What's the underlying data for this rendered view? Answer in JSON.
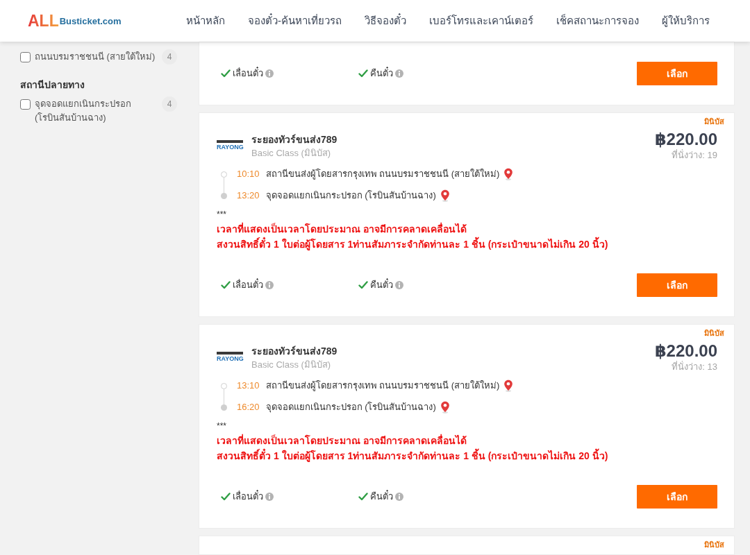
{
  "header": {
    "logo": {
      "brand": "ALL",
      "domain": "Busticket.com"
    },
    "nav": [
      {
        "label": "หน้าหลัก"
      },
      {
        "label": "จองตั๋ว-ค้นหาเที่ยวรถ"
      },
      {
        "label": "วิธีจองตั๋ว"
      },
      {
        "label": "เบอร์โทรและเคาน์เตอร์"
      },
      {
        "label": "เช็คสถานะการจอง"
      },
      {
        "label": "ผู้ให้บริการ"
      }
    ]
  },
  "sidebar": {
    "groups": [
      {
        "items": [
          {
            "label": "ถนนบรมราชชนนี (สายใต้ใหม่)",
            "count": "4",
            "checked": false
          }
        ]
      },
      {
        "heading": "สถานีปลายทาง",
        "items": [
          {
            "label": "จุดจอดแยกเนินกระปรอก (โรบินสันบ้านฉาง)",
            "count": "4",
            "checked": false
          }
        ]
      }
    ]
  },
  "trips": [
    {
      "features": [
        {
          "label": "เลื่อนตั๋ว",
          "allowed": true
        },
        {
          "label": "คืนตั๋ว",
          "allowed": true
        }
      ],
      "select_button": "เลือก"
    },
    {
      "tag": "มินิบัส",
      "operator": {
        "logo_text": "RAYONG",
        "name": "ระยองทัวร์ขนส่ง789",
        "class": "Basic Class (มินิบัส)"
      },
      "price": "฿220.00",
      "seats": "ที่นั่งว่าง: 19",
      "stops": [
        {
          "kind": "departure",
          "time": "10:10",
          "station": "สถานีขนส่งผู้โดยสารกรุงเทพ ถนนบรมราชชนนี (สายใต้ใหม่)"
        },
        {
          "kind": "arrival",
          "time": "13:20",
          "station": "จุดจอดแยกเนินกระปรอก (โรบินสันบ้านฉาง)"
        }
      ],
      "note_marker": "***",
      "notes": [
        "เวลาที่แสดงเป็นเวลาโดยประมาณ อาจมีการคลาดเคลื่อนได้",
        "สงวนสิทธิ์ตั๋ว 1 ใบต่อผู้โดยสาร 1ท่านสัมภาระจำกัดท่านละ 1 ชิ้น (กระเป๋าขนาดไม่เกิน 20 นิ้ว)"
      ],
      "features": [
        {
          "label": "เลื่อนตั๋ว",
          "allowed": true
        },
        {
          "label": "คืนตั๋ว",
          "allowed": true
        }
      ],
      "select_button": "เลือก"
    },
    {
      "tag": "มินิบัส",
      "operator": {
        "logo_text": "RAYONG",
        "name": "ระยองทัวร์ขนส่ง789",
        "class": "Basic Class (มินิบัส)"
      },
      "price": "฿220.00",
      "seats": "ที่นั่งว่าง: 13",
      "stops": [
        {
          "kind": "departure",
          "time": "13:10",
          "station": "สถานีขนส่งผู้โดยสารกรุงเทพ ถนนบรมราชชนนี (สายใต้ใหม่)"
        },
        {
          "kind": "arrival",
          "time": "16:20",
          "station": "จุดจอดแยกเนินกระปรอก (โรบินสันบ้านฉาง)"
        }
      ],
      "note_marker": "***",
      "notes": [
        "เวลาที่แสดงเป็นเวลาโดยประมาณ อาจมีการคลาดเคลื่อนได้",
        "สงวนสิทธิ์ตั๋ว 1 ใบต่อผู้โดยสาร 1ท่านสัมภาระจำกัดท่านละ 1 ชิ้น (กระเป๋าขนาดไม่เกิน 20 นิ้ว)"
      ],
      "features": [
        {
          "label": "เลื่อนตั๋ว",
          "allowed": true
        },
        {
          "label": "คืนตั๋ว",
          "allowed": true
        }
      ],
      "select_button": "เลือก"
    },
    {
      "tag": "มินิบัส"
    }
  ]
}
